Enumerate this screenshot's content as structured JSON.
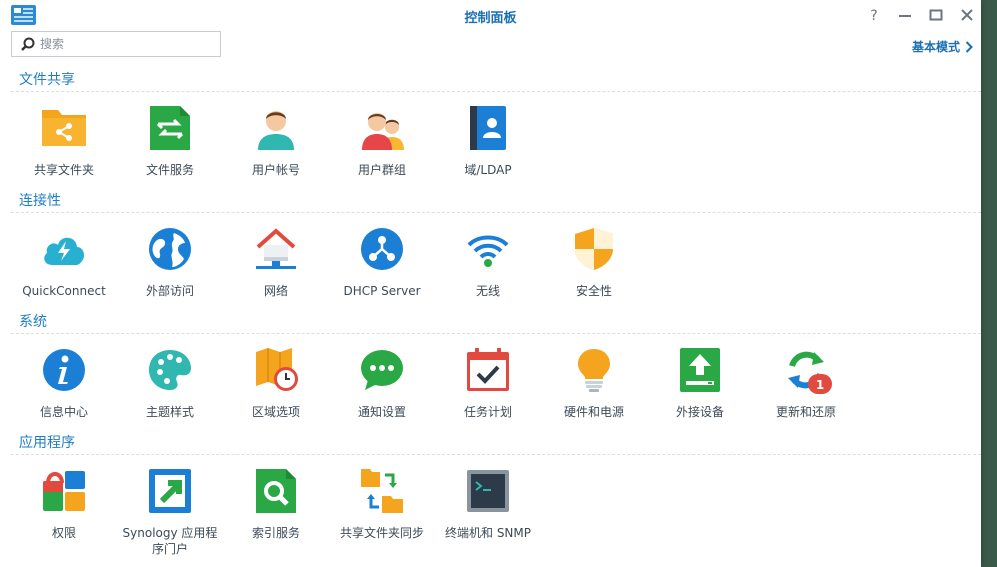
{
  "window": {
    "title": "控制面板"
  },
  "search": {
    "placeholder": "搜索"
  },
  "mode_link": {
    "label": "基本模式"
  },
  "sections": [
    {
      "title": "文件共享",
      "items": [
        {
          "label": "共享文件夹",
          "icon": "shared-folder-icon"
        },
        {
          "label": "文件服务",
          "icon": "file-services-icon"
        },
        {
          "label": "用户帐号",
          "icon": "user-account-icon"
        },
        {
          "label": "用户群组",
          "icon": "user-group-icon"
        },
        {
          "label": "域/LDAP",
          "icon": "domain-ldap-icon"
        }
      ]
    },
    {
      "title": "连接性",
      "items": [
        {
          "label": "QuickConnect",
          "icon": "quickconnect-icon"
        },
        {
          "label": "外部访问",
          "icon": "external-access-icon"
        },
        {
          "label": "网络",
          "icon": "network-icon"
        },
        {
          "label": "DHCP Server",
          "icon": "dhcp-server-icon"
        },
        {
          "label": "无线",
          "icon": "wireless-icon"
        },
        {
          "label": "安全性",
          "icon": "security-icon"
        }
      ]
    },
    {
      "title": "系统",
      "items": [
        {
          "label": "信息中心",
          "icon": "info-center-icon"
        },
        {
          "label": "主题样式",
          "icon": "theme-icon"
        },
        {
          "label": "区域选项",
          "icon": "regional-options-icon"
        },
        {
          "label": "通知设置",
          "icon": "notification-icon"
        },
        {
          "label": "任务计划",
          "icon": "task-scheduler-icon"
        },
        {
          "label": "硬件和电源",
          "icon": "hardware-power-icon"
        },
        {
          "label": "外接设备",
          "icon": "external-devices-icon"
        },
        {
          "label": "更新和还原",
          "icon": "update-restore-icon",
          "badge": "1"
        }
      ]
    },
    {
      "title": "应用程序",
      "items": [
        {
          "label": "权限",
          "icon": "privileges-icon"
        },
        {
          "label": "Synology 应用程序门户",
          "icon": "application-portal-icon"
        },
        {
          "label": "索引服务",
          "icon": "indexing-service-icon"
        },
        {
          "label": "共享文件夹同步",
          "icon": "shared-folder-sync-icon"
        },
        {
          "label": "终端机和 SNMP",
          "icon": "terminal-snmp-icon"
        }
      ]
    }
  ],
  "colors": {
    "accent": "#1f7ec4",
    "title": "#1a6fb5",
    "label": "#3d4a57"
  }
}
